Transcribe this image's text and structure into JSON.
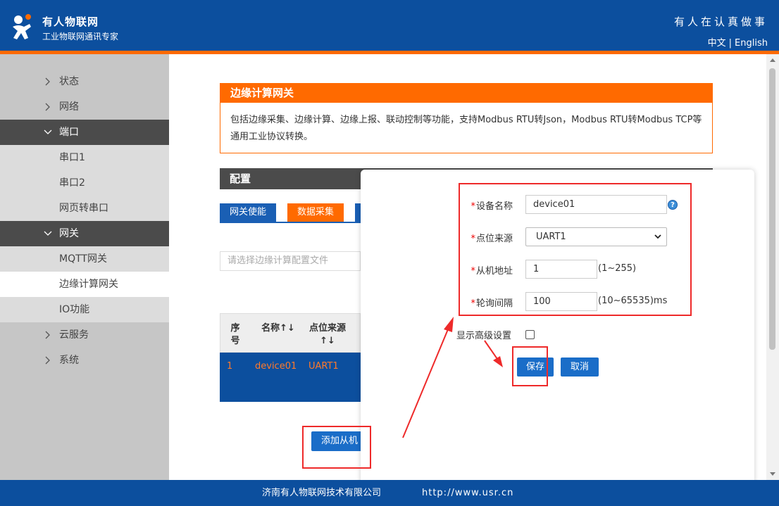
{
  "header": {
    "brand_name": "有人物联网",
    "brand_sub": "工业物联网通讯专家",
    "slogan": "有人在认真做事",
    "lang_zh": "中文",
    "lang_sep": "|",
    "lang_en": "English"
  },
  "sidebar": {
    "items": [
      {
        "label": "状态"
      },
      {
        "label": "网络"
      },
      {
        "label": "端口"
      },
      {
        "label": "串口1"
      },
      {
        "label": "串口2"
      },
      {
        "label": "网页转串口"
      },
      {
        "label": "网关"
      },
      {
        "label": "MQTT网关"
      },
      {
        "label": "边缘计算网关"
      },
      {
        "label": "IO功能"
      },
      {
        "label": "云服务"
      },
      {
        "label": "系统"
      }
    ]
  },
  "intro": {
    "title": "边缘计算网关",
    "text": "包括边缘采集、边缘计算、边缘上报、联动控制等功能，支持Modbus RTU转Json，Modbus RTU转Modbus TCP等通用工业协议转换。"
  },
  "config": {
    "title": "配置",
    "tabs": [
      {
        "label": "网关使能"
      },
      {
        "label": "数据采集"
      }
    ],
    "file_placeholder": "请选择边缘计算配置文件",
    "table": {
      "headers": [
        "序号",
        "名称↑↓",
        "点位来源↑↓"
      ],
      "rows": [
        {
          "index": "1",
          "name": "device01",
          "source": "UART1"
        }
      ]
    },
    "add_slave_label": "添加从机"
  },
  "modal": {
    "device_name_label": "设备名称",
    "device_name_value": "device01",
    "source_label": "点位来源",
    "source_value": "UART1",
    "slave_addr_label": "从机地址",
    "slave_addr_value": "1",
    "slave_addr_hint": "(1~255)",
    "poll_label": "轮询间隔",
    "poll_value": "100",
    "poll_hint": "(10~65535)ms",
    "advanced_label": "显示高级设置",
    "save_label": "保存",
    "cancel_label": "取消",
    "required_mark": "*",
    "help_glyph": "?"
  },
  "footer": {
    "company": "济南有人物联网技术有限公司",
    "url": "http://www.usr.cn"
  },
  "colors": {
    "brand_blue": "#0c4f9e",
    "accent_orange": "#ff6a00",
    "annotation_red": "#ee2a2a"
  }
}
